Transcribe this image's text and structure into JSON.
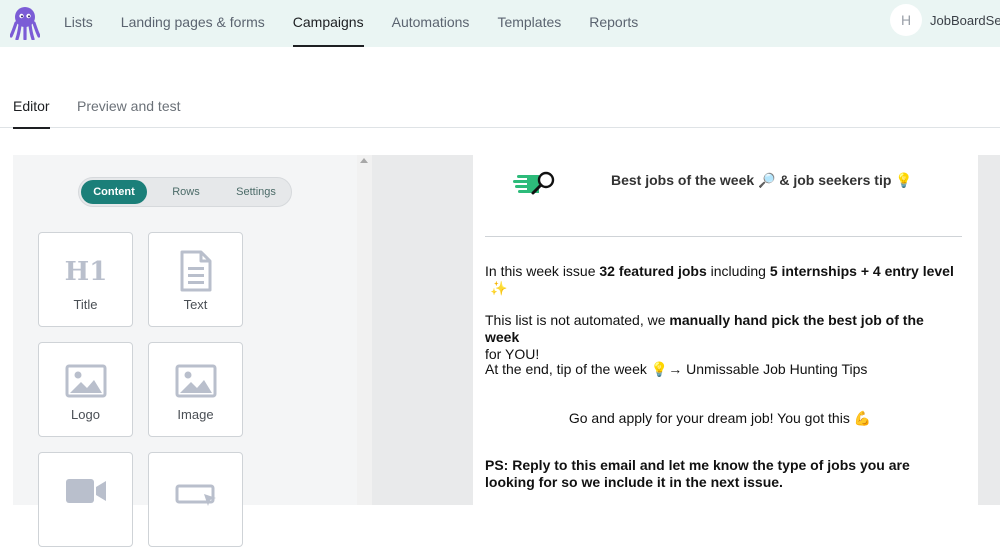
{
  "nav": {
    "items": [
      "Lists",
      "Landing pages & forms",
      "Campaigns",
      "Automations",
      "Templates",
      "Reports"
    ],
    "active": "Campaigns",
    "avatar_initial": "H",
    "account_name": "JobBoardSe"
  },
  "tabs": {
    "editor": "Editor",
    "preview": "Preview and test",
    "active": "Editor"
  },
  "panel": {
    "segments": {
      "content": "Content",
      "rows": "Rows",
      "settings": "Settings",
      "active": "Content"
    },
    "blocks": {
      "title": "Title",
      "text": "Text",
      "logo": "Logo",
      "image": "Image"
    }
  },
  "email": {
    "headline": "Best jobs of the week 🔎 & job seekers tip 💡",
    "p1_pre": "In this week issue ",
    "p1_b1": "32 featured jobs",
    "p1_mid": " including ",
    "p1_b2": "5 internships + 4 entry level",
    "p1_emoji": "✨",
    "p2_pre": "This list is not automated, we ",
    "p2_b": "manually hand pick the best job of the week",
    "p2_post": "for YOU!",
    "p3": "At the end, tip of the week 💡→  Unmissable Job Hunting Tips",
    "p4": "Go and apply for your dream job! You got this 💪",
    "p5": "PS: Reply to this email and let me know the type of jobs you are looking for so we include it in the next issue."
  },
  "colors": {
    "topbar_bg": "#eaf5f3",
    "accent": "#1b7f79",
    "logo_purple": "#7b5cd6",
    "icon_gray": "#b9bfcc"
  }
}
